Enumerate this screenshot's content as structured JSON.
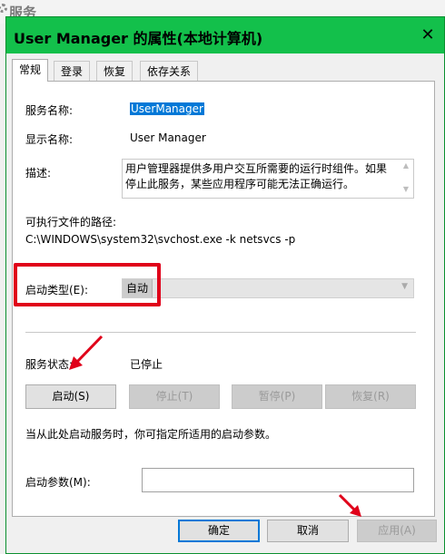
{
  "background_window": {
    "title": "服务"
  },
  "dialog": {
    "title": "User Manager 的属性(本地计算机)",
    "close_glyph": "✕"
  },
  "tabs": [
    {
      "label": "常规",
      "active": true
    },
    {
      "label": "登录",
      "active": false
    },
    {
      "label": "恢复",
      "active": false
    },
    {
      "label": "依存关系",
      "active": false
    }
  ],
  "general": {
    "service_name_label": "服务名称:",
    "service_name_value": "UserManager",
    "display_name_label": "显示名称:",
    "display_name_value": "User Manager",
    "description_label": "描述:",
    "description_value": "用户管理器提供多用户交互所需要的运行时组件。如果停止此服务，某些应用程序可能无法正确运行。",
    "path_label": "可执行文件的路径:",
    "path_value": "C:\\WINDOWS\\system32\\svchost.exe -k netsvcs -p",
    "startup_type_label": "启动类型(E):",
    "startup_type_value": "自动",
    "status_label": "服务状态:",
    "status_value": "已停止",
    "start_button": "启动(S)",
    "stop_button": "停止(T)",
    "pause_button": "暂停(P)",
    "resume_button": "恢复(R)",
    "hint_text": "当从此处启动服务时，你可指定所适用的启动参数。",
    "params_label": "启动参数(M):",
    "params_value": ""
  },
  "footer": {
    "ok": "确定",
    "cancel": "取消",
    "apply": "应用(A)"
  },
  "colors": {
    "titlebar": "#13c04b",
    "highlight_box": "#e0001a",
    "annotation_arrow": "#e0001a",
    "selection": "#0078d7"
  }
}
